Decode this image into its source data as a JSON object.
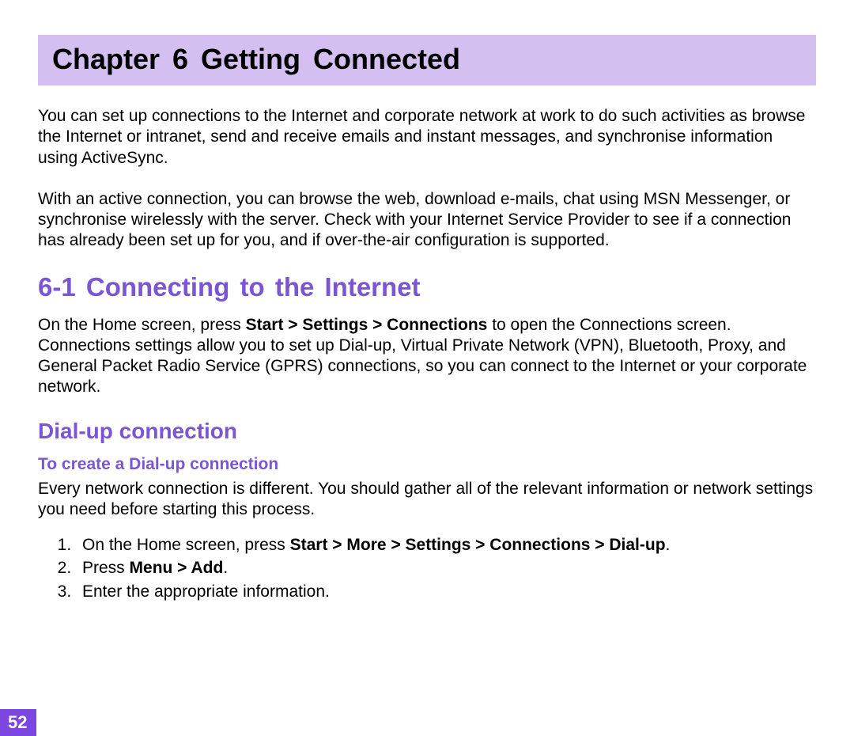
{
  "chapter": {
    "banner": "Chapter  6    Getting Connected"
  },
  "intro": {
    "para1": "You can set up connections to the Internet and corporate network at work to do such activities as browse the Internet or intranet, send and receive emails and instant messages, and synchronise information using ActiveSync.",
    "para2": "With an active connection, you can browse the web, download e-mails, chat using MSN Messenger, or synchronise wirelessly with the server. Check with your Internet Service Provider to see if a connection has already been set up for you, and if over-the-air configuration is supported."
  },
  "section": {
    "number": "6-1",
    "title": "Connecting to the Internet",
    "heading": "6-1  Connecting to the Internet",
    "para_pre": "On the Home screen, press ",
    "para_bold": "Start  > Settings > Connections",
    "para_post": " to open the Connections screen. Connections settings allow you to set up Dial-up, Virtual Private Network (VPN), Bluetooth, Proxy, and General Packet Radio Service (GPRS) connections, so you can connect to the Internet or your corporate network."
  },
  "subsection": {
    "title": "Dial-up connection",
    "sub_title": "To create a Dial-up connection",
    "sub_para": "Every network connection is different. You should gather all of the relevant information or network settings you need before starting this process."
  },
  "steps": {
    "s1_pre": "On the Home screen, press ",
    "s1_bold": "Start > More > Settings > Connections > Dial-up",
    "s1_post": ".",
    "s2_pre": "Press ",
    "s2_bold": "Menu > Add",
    "s2_post": ".",
    "s3": "Enter the appropriate information."
  },
  "pageNumber": "52"
}
